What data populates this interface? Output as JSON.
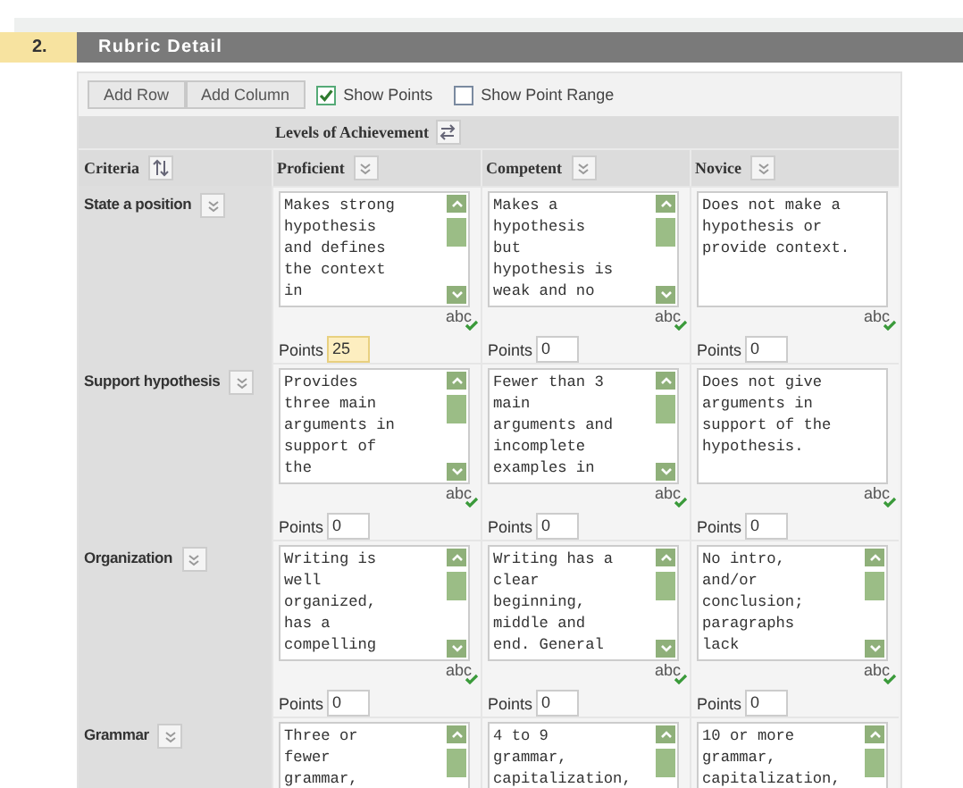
{
  "section": {
    "number": "2.",
    "title": "Rubric Detail"
  },
  "toolbar": {
    "buttons": [
      "Add Row",
      "Add Column"
    ],
    "checkboxes": [
      {
        "label": "Show Points",
        "checked": true
      },
      {
        "label": "Show Point Range",
        "checked": false
      }
    ]
  },
  "levels_heading": "Levels of Achievement",
  "criteria_heading": "Criteria",
  "columns": [
    "Proficient",
    "Competent",
    "Novice"
  ],
  "rows": [
    {
      "criterion": "State a position",
      "cells": [
        {
          "text": "Makes strong\nhypothesis\nand defines\nthe context\nin",
          "scrollable": true,
          "spell": "abc",
          "points_label": "Points",
          "points": "25",
          "focused": true
        },
        {
          "text": "Makes a\nhypothesis\nbut\nhypothesis is\nweak and no",
          "scrollable": true,
          "spell": "abc",
          "points_label": "Points",
          "points": "0",
          "focused": false
        },
        {
          "text": "Does not make a\nhypothesis or\nprovide context.",
          "scrollable": false,
          "spell": "abc",
          "points_label": "Points",
          "points": "0",
          "focused": false
        }
      ]
    },
    {
      "criterion": "Support hypothesis",
      "cells": [
        {
          "text": "Provides\nthree main\narguments in\nsupport of\nthe",
          "scrollable": true,
          "spell": "abc",
          "points_label": "Points",
          "points": "0",
          "focused": false
        },
        {
          "text": "Fewer than 3\nmain\narguments and\nincomplete\nexamples in",
          "scrollable": true,
          "spell": "abc",
          "points_label": "Points",
          "points": "0",
          "focused": false
        },
        {
          "text": "Does not give\narguments in\nsupport of the\nhypothesis.",
          "scrollable": false,
          "spell": "abc",
          "points_label": "Points",
          "points": "0",
          "focused": false
        }
      ]
    },
    {
      "criterion": "Organization",
      "cells": [
        {
          "text": "Writing is\nwell\norganized,\nhas a\ncompelling",
          "scrollable": true,
          "spell": "abc",
          "points_label": "Points",
          "points": "0",
          "focused": false
        },
        {
          "text": "Writing has a\nclear\nbeginning,\nmiddle and\nend. General",
          "scrollable": true,
          "spell": "abc",
          "points_label": "Points",
          "points": "0",
          "focused": false
        },
        {
          "text": "No intro,\nand/or\nconclusion;\nparagraphs\nlack",
          "scrollable": true,
          "spell": "abc",
          "points_label": "Points",
          "points": "0",
          "focused": false
        }
      ]
    },
    {
      "criterion": "Grammar",
      "cells": [
        {
          "text": "Three or\nfewer\ngrammar,",
          "scrollable": true
        },
        {
          "text": "4 to 9\ngrammar,\ncapitalization,",
          "scrollable": true
        },
        {
          "text": "10 or more\ngrammar,\ncapitalization,",
          "scrollable": true
        }
      ]
    }
  ]
}
